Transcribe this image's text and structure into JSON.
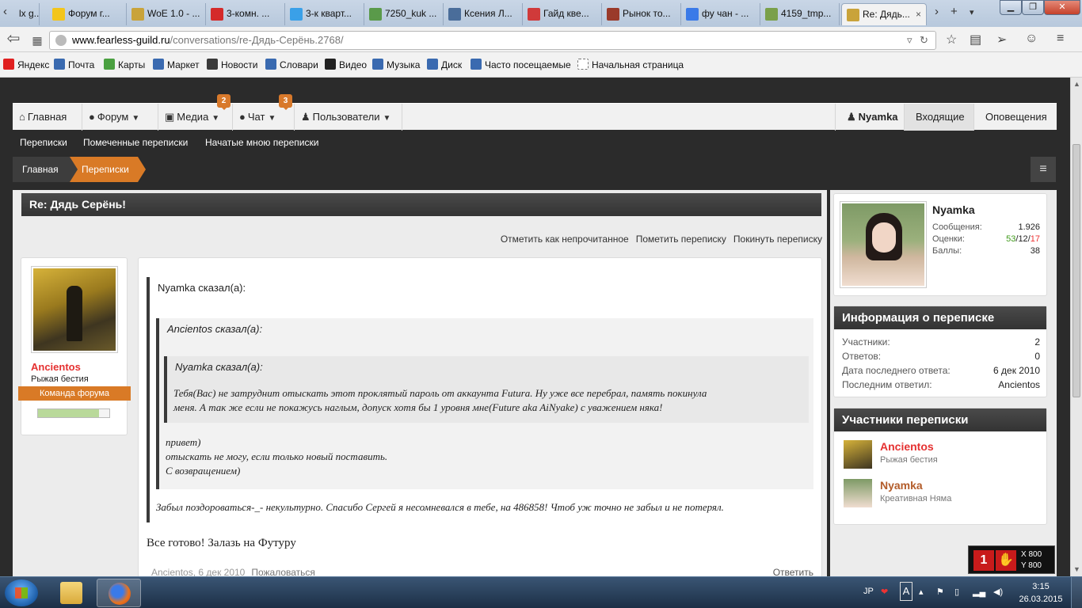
{
  "browser": {
    "tabs": [
      {
        "label": "lx g...",
        "fav_color": "#8a8a8a"
      },
      {
        "label": "Форум г...",
        "fav_color": "#f3c51b"
      },
      {
        "label": "WoE 1.0 - ...",
        "fav_color": "#c9a33a"
      },
      {
        "label": "3-комн. ...",
        "fav_color": "#d42a2a"
      },
      {
        "label": "3-к кварт...",
        "fav_color": "#3aa0e8"
      },
      {
        "label": "7250_kuk ...",
        "fav_color": "#5a9a4a"
      },
      {
        "label": "Ксения Л...",
        "fav_color": "#4a6d9a"
      },
      {
        "label": "Гайд кве...",
        "fav_color": "#d03a3a"
      },
      {
        "label": "Рынок то...",
        "fav_color": "#9a3a2a"
      },
      {
        "label": "фу чан - ...",
        "fav_color": "#3a7ae8"
      },
      {
        "label": "4159_tmp...",
        "fav_color": "#7aa04a"
      },
      {
        "label": "Re: Дядь...",
        "fav_color": "#c9a33a"
      }
    ],
    "url_domain": "www.fearless-guild.ru",
    "url_path": "/conversations/re-Дядь-Серёнь.2768/",
    "bookmarks": [
      {
        "label": "Яндекс",
        "color": "#e02020"
      },
      {
        "label": "Почта",
        "color": "#3a6ab0"
      },
      {
        "label": "Карты",
        "color": "#4aa040"
      },
      {
        "label": "Маркет",
        "color": "#3a6ab0"
      },
      {
        "label": "Новости",
        "color": "#3a3a3a"
      },
      {
        "label": "Словари",
        "color": "#3a6ab0"
      },
      {
        "label": "Видео",
        "color": "#222222"
      },
      {
        "label": "Музыка",
        "color": "#3a6ab0"
      },
      {
        "label": "Диск",
        "color": "#3a6ab0"
      },
      {
        "label": "Часто посещаемые",
        "color": "#3a6ab0"
      },
      {
        "label": "Начальная страница",
        "color": "#ffffff"
      }
    ]
  },
  "nav": {
    "home": "Главная",
    "forum": "Форум",
    "media": "Медиа",
    "media_badge": "2",
    "chat": "Чат",
    "chat_badge": "3",
    "users": "Пользователи",
    "account": "Nyamka",
    "inbox": "Входящие",
    "alerts": "Оповещения"
  },
  "subnav": [
    "Переписки",
    "Помеченные переписки",
    "Начатые мною переписки"
  ],
  "breadcrumb": {
    "home": "Главная",
    "current": "Переписки"
  },
  "thread": {
    "title": "Re: Дядь Серёнь!",
    "actions": [
      "Отметить как непрочитанное",
      "Пометить переписку",
      "Покинуть переписку"
    ]
  },
  "post": {
    "author": {
      "name": "Ancientos",
      "title": "Рыжая бестия",
      "ribbon": "Команда форума",
      "bar_fill": 0.85
    },
    "quote_outer": {
      "head": "Nyamka сказал(а):",
      "tail": "Забыл поздороваться-_- некультурно. Спасибо Сергей я несомневался в тебе, на 486858! Чтоб уж точно не забыл и не потерял."
    },
    "quote_middle": {
      "head": "Ancientos сказал(а):",
      "lines": [
        "привет)",
        "отыскать не могу, если только новый поставить.",
        "С возвращением)"
      ]
    },
    "quote_inner": {
      "head": "Nyamka сказал(а):",
      "line1": "Тебя(Вас) не затруднит отыскать этот проклятый пароль от аккаунта Futura. Ну уже все перебрал, память покинула",
      "line2": "меня. А так же если не покажусь наглым, допуск хотя бы 1 уровня мне(Future aka AiNyake) с уважением няка!"
    },
    "body": "Все готово! Залазь на Футуру",
    "footer_author": "Ancientos,",
    "footer_date": "6 дек 2010",
    "report": "Пожаловаться",
    "reply": "Ответить"
  },
  "sidebar": {
    "user": {
      "name": "Nyamka",
      "messages_label": "Сообщения:",
      "messages": "1.926",
      "ratings_label": "Оценки:",
      "ratings_pos": "53",
      "ratings_neu": "12",
      "ratings_neg": "17",
      "points_label": "Баллы:",
      "points": "38"
    },
    "info": {
      "title": "Информация о переписке",
      "rows": [
        {
          "label": "Участники:",
          "value": "2"
        },
        {
          "label": "Ответов:",
          "value": "0"
        },
        {
          "label": "Дата последнего ответа:",
          "value": "6 дек 2010"
        },
        {
          "label": "Последним ответил:",
          "value": "Ancientos"
        }
      ]
    },
    "participants": {
      "title": "Участники переписки",
      "list": [
        {
          "name": "Ancientos",
          "title": "Рыжая бестия",
          "color": "#e53131"
        },
        {
          "name": "Nyamka",
          "title": "Креативная Няма",
          "color": "#b35c2a"
        }
      ]
    }
  },
  "overlay": {
    "x": "X 800",
    "y": "Y 800"
  },
  "taskbar": {
    "lang": "JP",
    "time": "3:15",
    "date": "26.03.2015"
  },
  "colors": {
    "accent": "#d97a26",
    "dark_header": "#3a3a3a",
    "author_red": "#e53131"
  }
}
